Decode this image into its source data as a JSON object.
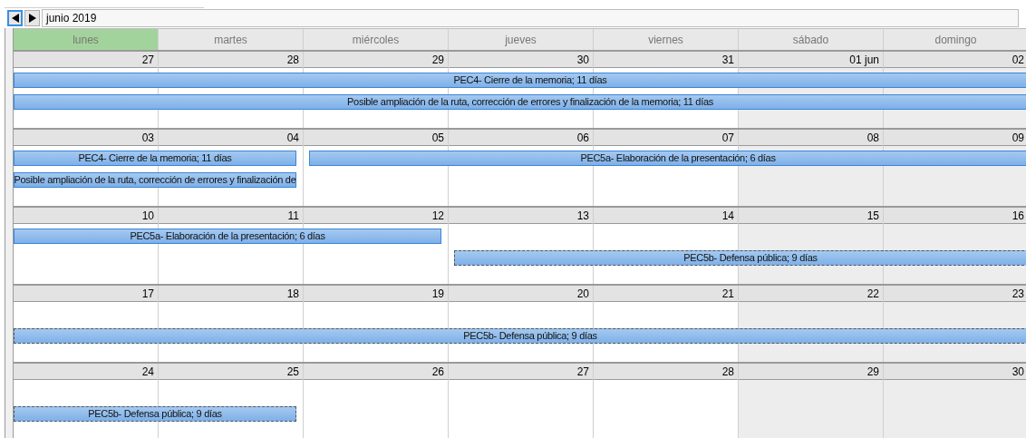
{
  "toolbar": {
    "prev_selected": true,
    "title": "junio 2019"
  },
  "day_headers": [
    {
      "label": "lunes",
      "selected": true,
      "weekend": false
    },
    {
      "label": "martes",
      "selected": false,
      "weekend": false
    },
    {
      "label": "miércoles",
      "selected": false,
      "weekend": false
    },
    {
      "label": "jueves",
      "selected": false,
      "weekend": false
    },
    {
      "label": "viernes",
      "selected": false,
      "weekend": false
    },
    {
      "label": "sábado",
      "selected": false,
      "weekend": true
    },
    {
      "label": "domingo",
      "selected": false,
      "weekend": true
    }
  ],
  "weeks": [
    {
      "days": [
        "27",
        "28",
        "29",
        "30",
        "31",
        "01 jun",
        "02"
      ],
      "lanes": [
        {
          "cells": [
            {
              "kind": "start",
              "text": "PEC4- Cierre de la memoria; 11 días",
              "selected": false
            },
            {
              "kind": "more"
            },
            {
              "kind": "more"
            },
            {
              "kind": "more"
            },
            {
              "kind": "more"
            },
            {
              "kind": "more"
            },
            {
              "kind": "more"
            }
          ]
        },
        {
          "cells": [
            {
              "kind": "start",
              "text": "Posible ampliación de la ruta, corrección de errores y finalización de la memoria; 11 días",
              "selected": false
            },
            {
              "kind": "more"
            },
            {
              "kind": "more"
            },
            {
              "kind": "more"
            },
            {
              "kind": "more"
            },
            {
              "kind": "more"
            },
            {
              "kind": "more"
            }
          ]
        }
      ]
    },
    {
      "days": [
        "03",
        "04",
        "05",
        "06",
        "07",
        "08",
        "09"
      ],
      "lanes": [
        {
          "cells": [
            {
              "kind": "start",
              "text": "PEC4- Cierre de la memoria; 11 días",
              "selected": false
            },
            {
              "kind": "more"
            },
            {
              "kind": "start",
              "text": "PEC5a- Elaboración de la presentación; 6 días",
              "selected": false
            },
            {
              "kind": "more"
            },
            {
              "kind": "more"
            },
            {
              "kind": "more"
            },
            {
              "kind": "more"
            }
          ]
        },
        {
          "cells": [
            {
              "kind": "start",
              "text": "Posible ampliación de la ruta, corrección de errores y finalización de",
              "selected": false
            },
            {
              "kind": "more"
            },
            {
              "kind": "empty"
            },
            {
              "kind": "empty"
            },
            {
              "kind": "empty"
            },
            {
              "kind": "empty"
            },
            {
              "kind": "empty"
            }
          ]
        }
      ]
    },
    {
      "days": [
        "10",
        "11",
        "12",
        "13",
        "14",
        "15",
        "16"
      ],
      "lanes": [
        {
          "cells": [
            {
              "kind": "start",
              "text": "PEC5a- Elaboración de la presentación; 6 días",
              "selected": false
            },
            {
              "kind": "more"
            },
            {
              "kind": "more"
            },
            {
              "kind": "empty"
            },
            {
              "kind": "empty"
            },
            {
              "kind": "empty"
            },
            {
              "kind": "empty"
            }
          ]
        },
        {
          "cells": [
            {
              "kind": "empty"
            },
            {
              "kind": "empty"
            },
            {
              "kind": "empty"
            },
            {
              "kind": "start",
              "text": "PEC5b- Defensa pública; 9 días",
              "selected": true
            },
            {
              "kind": "more"
            },
            {
              "kind": "more"
            },
            {
              "kind": "more"
            }
          ]
        }
      ]
    },
    {
      "days": [
        "17",
        "18",
        "19",
        "20",
        "21",
        "22",
        "23"
      ],
      "lanes": [
        {
          "cells": [
            {
              "kind": "empty"
            },
            {
              "kind": "empty"
            },
            {
              "kind": "empty"
            },
            {
              "kind": "empty"
            },
            {
              "kind": "empty"
            },
            {
              "kind": "empty"
            },
            {
              "kind": "empty"
            }
          ]
        },
        {
          "cells": [
            {
              "kind": "start",
              "text": "PEC5b- Defensa pública; 9 días",
              "selected": true
            },
            {
              "kind": "more"
            },
            {
              "kind": "more"
            },
            {
              "kind": "more"
            },
            {
              "kind": "more"
            },
            {
              "kind": "more"
            },
            {
              "kind": "more"
            }
          ]
        }
      ]
    },
    {
      "days": [
        "24",
        "25",
        "26",
        "27",
        "28",
        "29",
        "30"
      ],
      "lanes": [
        {
          "cells": [
            {
              "kind": "empty"
            },
            {
              "kind": "empty"
            },
            {
              "kind": "empty"
            },
            {
              "kind": "empty"
            },
            {
              "kind": "empty"
            },
            {
              "kind": "empty"
            },
            {
              "kind": "empty"
            }
          ]
        },
        {
          "cells": [
            {
              "kind": "start",
              "text": "PEC5b- Defensa pública; 9 días",
              "selected": true
            },
            {
              "kind": "more"
            },
            {
              "kind": "empty"
            },
            {
              "kind": "empty"
            },
            {
              "kind": "empty"
            },
            {
              "kind": "empty"
            },
            {
              "kind": "empty"
            }
          ]
        }
      ]
    }
  ]
}
